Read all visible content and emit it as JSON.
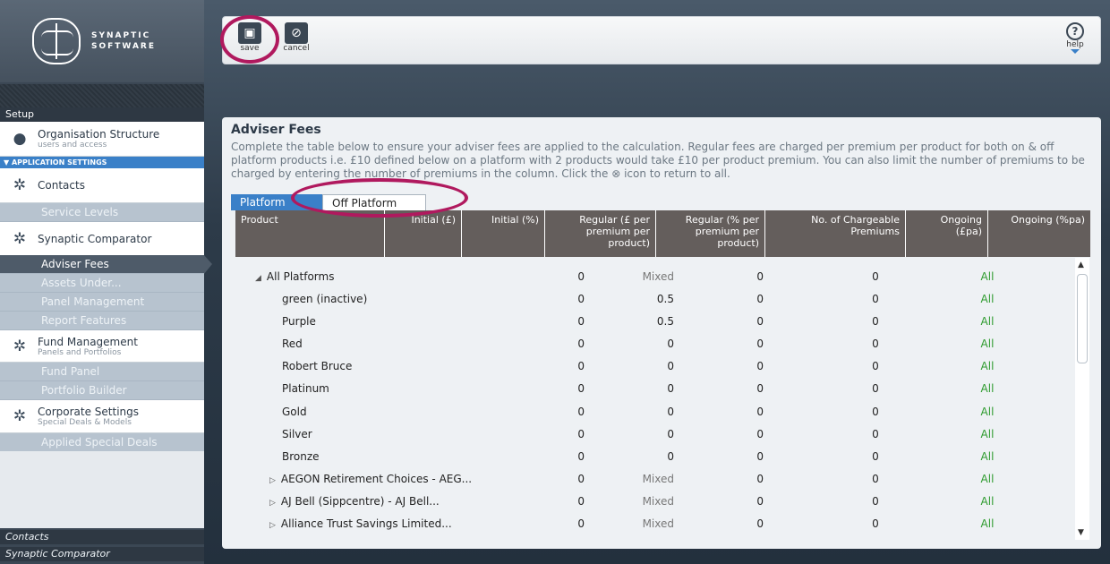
{
  "brand": {
    "line1": "SYNAPTIC",
    "line2": "SOFTWARE"
  },
  "toolbar": {
    "save_label": "save",
    "cancel_label": "cancel",
    "help_label": "help"
  },
  "sidebar": {
    "setup_header": "Setup",
    "org": {
      "title": "Organisation Structure",
      "subtitle": "users and access"
    },
    "app_settings": "APPLICATION SETTINGS",
    "contacts": "Contacts",
    "service_levels": "Service Levels",
    "comparator": "Synaptic Comparator",
    "adviser_fees": "Adviser Fees",
    "assets_under": "Assets Under...",
    "panel_mgmt": "Panel Management",
    "report_features": "Report Features",
    "fund_mgmt": {
      "title": "Fund Management",
      "subtitle": "Panels and Portfolios"
    },
    "fund_panel": "Fund Panel",
    "portfolio_builder": "Portfolio Builder",
    "corporate": {
      "title": "Corporate Settings",
      "subtitle": "Special Deals & Models"
    },
    "applied_deals": "Applied Special Deals",
    "footer1": "Contacts",
    "footer2": "Synaptic Comparator"
  },
  "panel": {
    "title": "Adviser Fees",
    "description": "Complete the table below to ensure your adviser fees are applied to the calculation. Regular fees are charged per premium per product for both on & off platform products i.e. £10 defined below on a platform with 2 products would take £10 per product premium. You can also limit the number of premiums to be charged by entering the number of premiums in the column. Click the ⊗ icon to return to all.",
    "tab_platform": "Platform",
    "tab_off_platform": "Off Platform"
  },
  "table": {
    "headers": [
      "Product",
      "Initial (£)",
      "Initial (%)",
      "Regular (£ per premium per product)",
      "Regular (% per premium per product)",
      "No. of Chargeable Premiums",
      "Ongoing (£pa)",
      "Ongoing (%pa)"
    ],
    "rows": [
      {
        "name": "All Platforms",
        "kind": "group",
        "init": "0",
        "pct": "Mixed",
        "reg": "0",
        "count": "0",
        "all": "All"
      },
      {
        "name": "green (inactive)",
        "kind": "child",
        "init": "0",
        "pct": "0.5",
        "reg": "0",
        "count": "0",
        "all": "All"
      },
      {
        "name": "Purple",
        "kind": "child",
        "init": "0",
        "pct": "0.5",
        "reg": "0",
        "count": "0",
        "all": "All"
      },
      {
        "name": "Red",
        "kind": "child",
        "init": "0",
        "pct": "0",
        "reg": "0",
        "count": "0",
        "all": "All"
      },
      {
        "name": "Robert Bruce",
        "kind": "child",
        "init": "0",
        "pct": "0",
        "reg": "0",
        "count": "0",
        "all": "All"
      },
      {
        "name": "Platinum",
        "kind": "child",
        "init": "0",
        "pct": "0",
        "reg": "0",
        "count": "0",
        "all": "All"
      },
      {
        "name": "Gold",
        "kind": "child",
        "init": "0",
        "pct": "0",
        "reg": "0",
        "count": "0",
        "all": "All"
      },
      {
        "name": "Silver",
        "kind": "child",
        "init": "0",
        "pct": "0",
        "reg": "0",
        "count": "0",
        "all": "All"
      },
      {
        "name": "Bronze",
        "kind": "child",
        "init": "0",
        "pct": "0",
        "reg": "0",
        "count": "0",
        "all": "All"
      },
      {
        "name": "AEGON Retirement Choices - AEG...",
        "kind": "collapsed",
        "init": "0",
        "pct": "Mixed",
        "reg": "0",
        "count": "0",
        "all": "All"
      },
      {
        "name": "AJ Bell (Sippcentre) - AJ Bell...",
        "kind": "collapsed",
        "init": "0",
        "pct": "Mixed",
        "reg": "0",
        "count": "0",
        "all": "All"
      },
      {
        "name": "Alliance Trust Savings Limited...",
        "kind": "collapsed",
        "init": "0",
        "pct": "Mixed",
        "reg": "0",
        "count": "0",
        "all": "All"
      }
    ]
  }
}
